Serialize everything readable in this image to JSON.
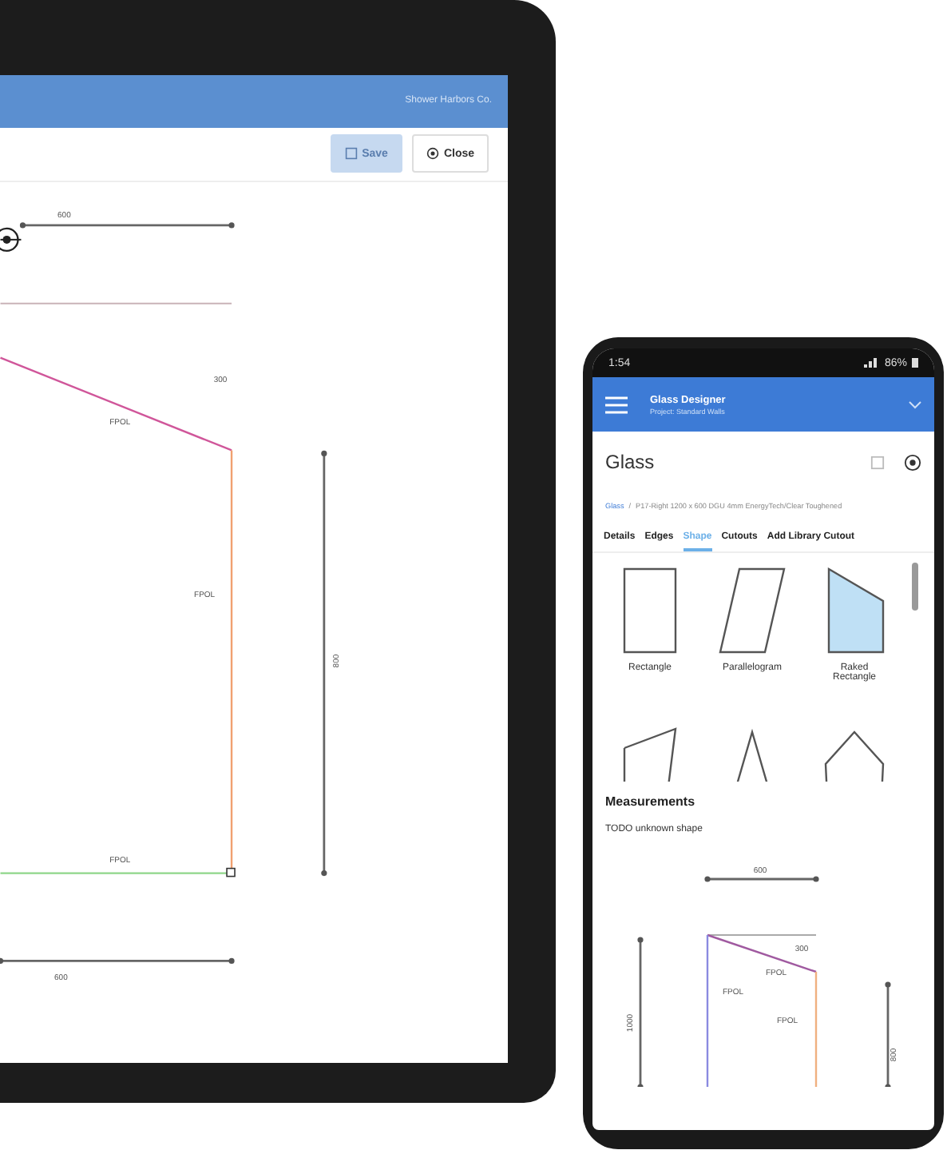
{
  "laptop": {
    "header": {
      "account": "Shower Harbors Co."
    },
    "toolbar": {
      "buttons": [
        {
          "label": "Save",
          "disabled": true
        },
        {
          "label": "Close",
          "disabled": false
        }
      ]
    },
    "drawing": {
      "top_dimension": "600",
      "raked_dimension": "300",
      "right_dimension": "800",
      "bottom_dimension": "600",
      "edge_labels": [
        "FPOL",
        "FPOL",
        "FPOL"
      ]
    }
  },
  "phone": {
    "status_bar": {
      "time": "1:54",
      "battery": "86%"
    },
    "header": {
      "title": "Glass Designer",
      "subtitle": "Project: Standard Walls"
    },
    "page_title": "Glass",
    "breadcrumb_separator": "/",
    "breadcrumb": [
      {
        "label": "Glass"
      },
      {
        "label": "P17-Right 1200 x 600 DGU 4mm EnergyTech/Clear Toughened"
      }
    ],
    "tabs": [
      {
        "label": "Details",
        "selected": false
      },
      {
        "label": "Edges",
        "selected": false
      },
      {
        "label": "Shape",
        "selected": true
      },
      {
        "label": "Cutouts",
        "selected": false
      },
      {
        "label": "Add Library Cutout",
        "selected": false
      }
    ],
    "shapes": [
      {
        "kind": "rectangle",
        "label": "Rectangle",
        "selected": false
      },
      {
        "kind": "parallelogram",
        "label": "Parallelogram",
        "selected": false
      },
      {
        "kind": "raked",
        "label": "Raked Rectangle",
        "selected": true
      },
      {
        "kind": "quad",
        "selected": false
      },
      {
        "kind": "triangle",
        "selected": false
      },
      {
        "kind": "pentagon",
        "selected": false
      }
    ],
    "measurements": {
      "heading": "Measurements",
      "note": "TODO unknown shape",
      "drawing": {
        "top_dimension": "600",
        "raked_dimension": "300",
        "left_dimension": "1000",
        "right_dimension": "800",
        "edge_labels": [
          "FPOL",
          "FPOL",
          "FPOL"
        ]
      }
    }
  }
}
